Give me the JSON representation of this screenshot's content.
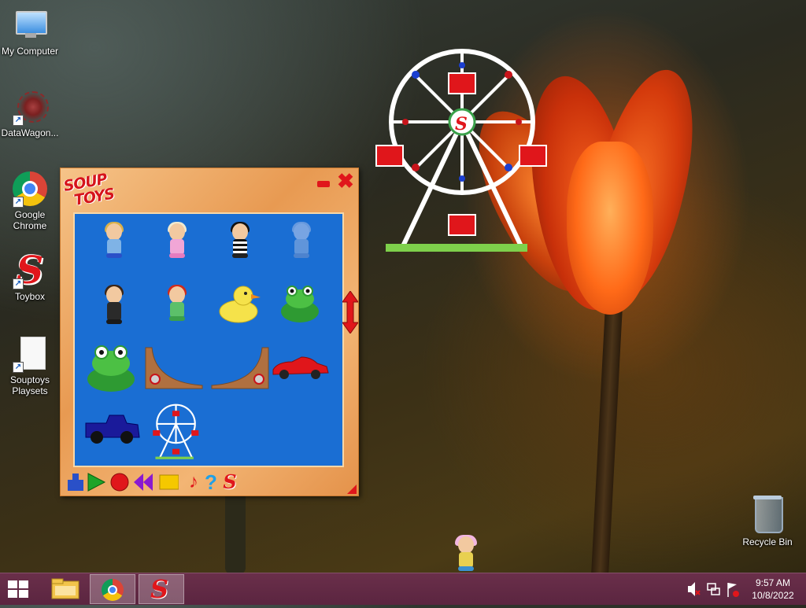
{
  "desktop": {
    "icons": [
      {
        "label": "My Computer",
        "icon": "computer-icon"
      },
      {
        "label": "DataWagon...",
        "icon": "datawagon-icon"
      },
      {
        "label": "Google Chrome",
        "icon": "chrome-icon"
      },
      {
        "label": "Toybox",
        "icon": "soup-s-icon"
      },
      {
        "label": "Souptoys Playsets",
        "icon": "document-icon"
      }
    ],
    "recycle_bin": {
      "label": "Recycle Bin",
      "icon": "recycle-bin-icon"
    }
  },
  "toybox": {
    "logo_line1": "SOUP",
    "logo_line2": "TOYS",
    "minimize_glyph": "",
    "close_glyph": "✖",
    "toys": [
      "boy-doll",
      "girl-doll",
      "striped-doll",
      "ghost-doll",
      "man-doll",
      "redhead-doll",
      "rubber-duck",
      "frog-small",
      "frog-large",
      "ramp-left",
      "ramp-right",
      "red-car",
      "blue-truck",
      "ferris-wheel"
    ],
    "toolbar": [
      "stamp-icon",
      "play-icon",
      "record-icon",
      "rewind-icon",
      "stop-icon",
      "music-note-icon",
      "help-icon",
      "soup-s-icon"
    ],
    "s_letter": "S",
    "question": "?",
    "note": "♪"
  },
  "taskbar": {
    "start_icon": "windows-icon",
    "pinned": [
      "file-explorer-icon",
      "chrome-icon",
      "soup-s-icon"
    ],
    "tray": [
      "volume-muted-icon",
      "network-icon",
      "action-center-flag-icon"
    ],
    "time": "9:57 AM",
    "date": "10/8/2022"
  },
  "colors": {
    "taskbar": "#5b2540",
    "soup_red": "#e0161b",
    "toy_area_blue": "#1a6ed3"
  }
}
